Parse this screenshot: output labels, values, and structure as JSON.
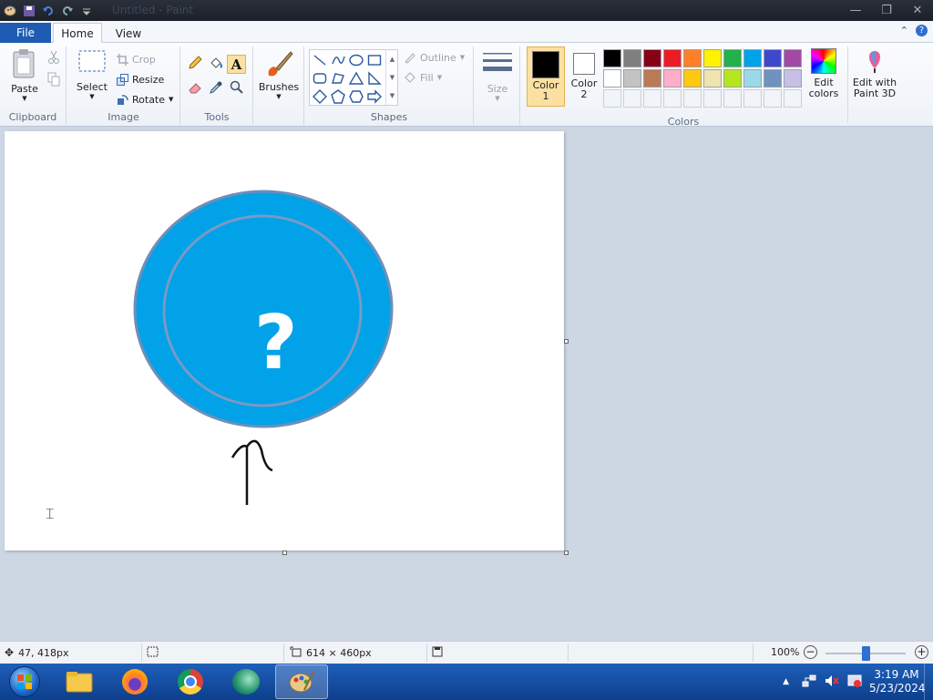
{
  "window": {
    "title": "Untitled - Paint"
  },
  "tabs": {
    "file": "File",
    "home": "Home",
    "view": "View"
  },
  "ribbon": {
    "clipboard": {
      "paste": "Paste",
      "label": "Clipboard"
    },
    "image": {
      "select": "Select",
      "crop": "Crop",
      "resize": "Resize",
      "rotate": "Rotate",
      "label": "Image"
    },
    "tools": {
      "label": "Tools"
    },
    "brushes": {
      "label": "Brushes"
    },
    "shapes": {
      "outline": "Outline",
      "fill": "Fill",
      "label": "Shapes"
    },
    "size": {
      "label": "Size"
    },
    "colors": {
      "color1": "Color",
      "color1_num": "1",
      "color2": "Color",
      "color2_num": "2",
      "edit": "Edit",
      "edit2": "colors",
      "paint3d_1": "Edit with",
      "paint3d_2": "Paint 3D",
      "label": "Colors",
      "row1": [
        "#000000",
        "#7f7f7f",
        "#880015",
        "#ed1c24",
        "#ff7f27",
        "#fff200",
        "#22b14c",
        "#00a2e8",
        "#3f48cc",
        "#a349a4"
      ],
      "row2": [
        "#ffffff",
        "#c3c3c3",
        "#b97a57",
        "#ffaec9",
        "#ffc90e",
        "#efe4b0",
        "#b5e61d",
        "#99d9ea",
        "#7092be",
        "#c8bfe7"
      ]
    }
  },
  "canvas_content": {
    "question_mark": "?"
  },
  "status": {
    "cursor_pos": "47, 418px",
    "canvas_size": "614 × 460px",
    "zoom": "100%",
    "zoom_level": 0.5
  },
  "taskbar": {
    "time": "3:19 AM",
    "date": "5/23/2024"
  }
}
